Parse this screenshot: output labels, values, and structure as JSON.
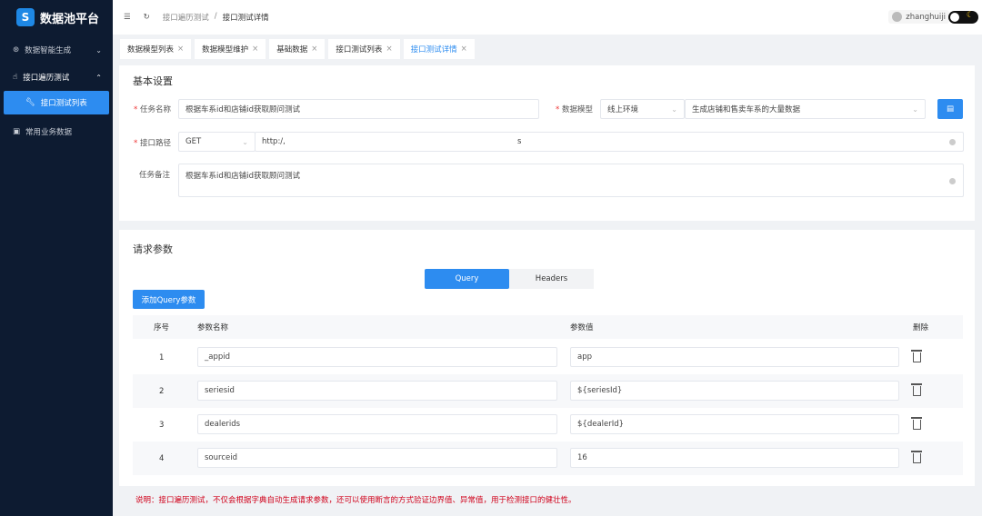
{
  "app": {
    "title": "数据池平台",
    "logo_glyph": "S"
  },
  "sidebar": {
    "items": [
      {
        "label": "数据智能生成",
        "icon": "grid-icon"
      },
      {
        "label": "接口遍历测试",
        "icon": "pointer-icon"
      },
      {
        "label": "接口测试列表",
        "icon": "wrench-icon"
      },
      {
        "label": "常用业务数据",
        "icon": "doc-icon"
      }
    ]
  },
  "header": {
    "breadcrumb": [
      "接口遍历测试",
      "接口测试详情"
    ],
    "separator": "/",
    "user": "zhanghuiji"
  },
  "tabs": [
    "数据模型列表",
    "数据模型维护",
    "基础数据",
    "接口测试列表",
    "接口测试详情"
  ],
  "basic": {
    "title": "基本设置",
    "task_name_label": "任务名称",
    "task_name": "根据车系id和店铺id获取顾问测试",
    "model_label": "数据模型",
    "env": "线上环境",
    "model": "生成店铺和售卖车系的大量数据",
    "path_label": "接口路径",
    "method": "GET",
    "url": "http:/,",
    "url_tail": "s",
    "remark_label": "任务备注",
    "remark": "根据车系id和店铺id获取顾问测试"
  },
  "params": {
    "title": "请求参数",
    "seg": [
      "Query",
      "Headers"
    ],
    "add_button": "添加Query参数",
    "columns": [
      "序号",
      "参数名称",
      "参数值",
      "删除"
    ],
    "rows": [
      {
        "no": "1",
        "name": "_appid",
        "value": "app"
      },
      {
        "no": "2",
        "name": "seriesid",
        "value": "${seriesId}"
      },
      {
        "no": "3",
        "name": "dealerids",
        "value": "${dealerId}"
      },
      {
        "no": "4",
        "name": "sourceid",
        "value": "16"
      }
    ]
  },
  "note": "说明：接口遍历测试，不仅会根据字典自动生成请求参数，还可以使用断言的方式验证边界值、异常值，用于检测接口的健壮性。",
  "colors": {
    "primary": "#2d8cf0",
    "sidebar": "#0d1b31",
    "note": "#d0021b"
  }
}
